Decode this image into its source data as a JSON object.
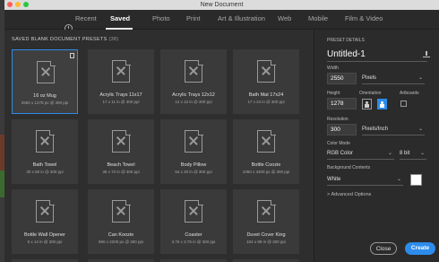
{
  "window": {
    "title": "New Document"
  },
  "tabs": [
    {
      "label": "Recent",
      "active": false
    },
    {
      "label": "Saved",
      "active": true
    },
    {
      "label": "Photo",
      "active": false
    },
    {
      "label": "Print",
      "active": false
    },
    {
      "label": "Art & Illustration",
      "active": false
    },
    {
      "label": "Web",
      "active": false
    },
    {
      "label": "Mobile",
      "active": false
    },
    {
      "label": "Film & Video",
      "active": false
    }
  ],
  "presets": {
    "header": "SAVED BLANK DOCUMENT PRESETS",
    "count": "(38)",
    "items": [
      {
        "name": "16 oz Mug",
        "dims": "2550 x 1278 px @ 300 ppi",
        "selected": true
      },
      {
        "name": "Acrylic Trays 11x17",
        "dims": "17 x 11 in @ 300 ppi"
      },
      {
        "name": "Acrylic Trays 12x12",
        "dims": "12 x 12 in @ 300 ppi"
      },
      {
        "name": "Bath Mat 17x24",
        "dims": "17 x 24 in @ 300 ppi"
      },
      {
        "name": "Bath Towel",
        "dims": "30 x 60 in @ 300 ppi"
      },
      {
        "name": "Beach Towel",
        "dims": "36 x 72 in @ 300 ppi"
      },
      {
        "name": "Body Pillow",
        "dims": "54 x 20 in @ 300 ppi"
      },
      {
        "name": "Bottle Coozie",
        "dims": "1050 x 3400 px @ 300 ppi"
      },
      {
        "name": "Bottle Wall Opener",
        "dims": "5 x 14 in @ 300 ppi"
      },
      {
        "name": "Can Koozie",
        "dims": "950 x 2200 px @ 300 ppi"
      },
      {
        "name": "Coaster",
        "dims": "3.75 x 3.75 in @ 300 ppi"
      },
      {
        "name": "Duvet Cover King",
        "dims": "104 x 88 in @ 300 ppi"
      }
    ]
  },
  "details": {
    "section_label": "PRESET DETAILS",
    "doc_name": "Untitled-1",
    "width_label": "Width",
    "width_value": "2550",
    "width_unit": "Pixels",
    "height_label": "Height",
    "height_value": "1278",
    "orientation_label": "Orientation",
    "artboards_label": "Artboards",
    "resolution_label": "Resolution",
    "resolution_value": "300",
    "resolution_unit": "Pixels/Inch",
    "color_mode_label": "Color Mode",
    "color_mode_value": "RGB Color",
    "bit_depth": "8 bit",
    "bg_label": "Background Contents",
    "bg_value": "White",
    "advanced_label": "Advanced Options",
    "close_label": "Close",
    "create_label": "Create"
  },
  "colors": {
    "accent": "#2d8ceb",
    "bg": "#323232"
  },
  "icons": [
    "clock-icon",
    "trash-icon",
    "document-icon",
    "save-preset-icon",
    "portrait-icon",
    "landscape-icon",
    "chevron-down-icon"
  ]
}
